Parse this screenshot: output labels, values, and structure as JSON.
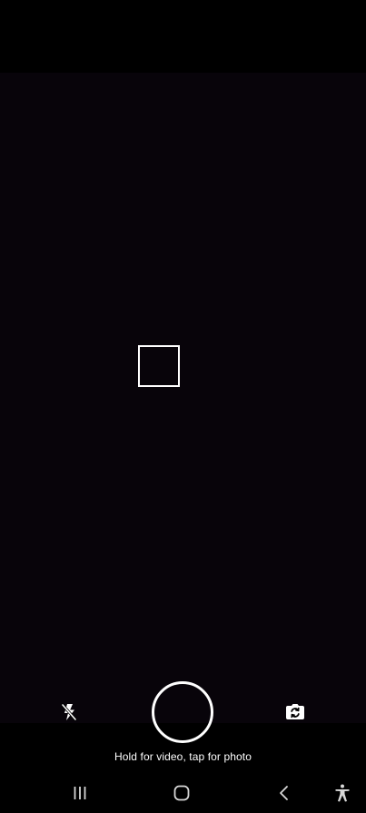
{
  "camera": {
    "hint_text": "Hold for video, tap for photo",
    "icons": {
      "flash": "flash-off-icon",
      "shutter": "shutter-icon",
      "switch_camera": "camera-switch-icon",
      "focus": "focus-square-icon"
    }
  },
  "navigation": {
    "icons": {
      "recents": "recents-icon",
      "home": "home-icon",
      "back": "back-icon",
      "accessibility": "accessibility-icon"
    }
  },
  "colors": {
    "viewfinder_bg": "#08040a",
    "foreground": "#ffffff"
  }
}
